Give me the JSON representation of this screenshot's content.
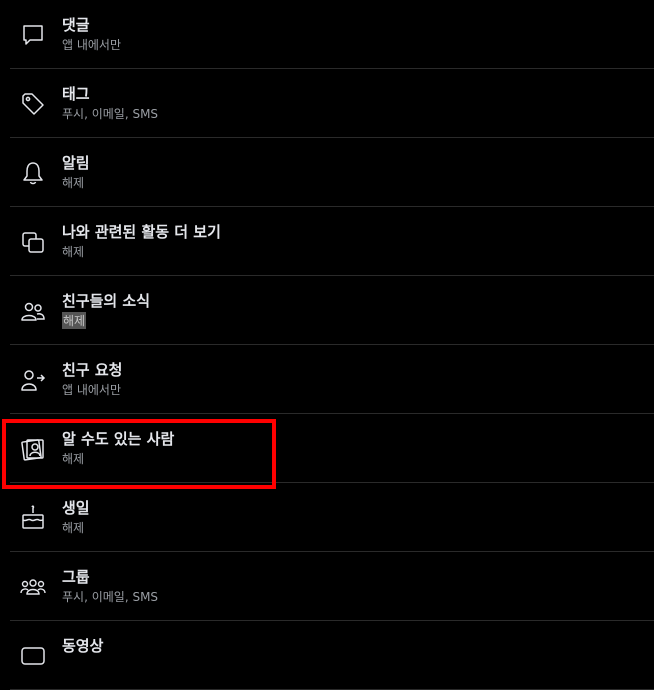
{
  "settings": {
    "items": [
      {
        "title": "댓글",
        "subtitle": "앱 내에서만",
        "icon": "comment-icon"
      },
      {
        "title": "태그",
        "subtitle": "푸시, 이메일, SMS",
        "icon": "tag-icon"
      },
      {
        "title": "알림",
        "subtitle": "해제",
        "icon": "bell-icon"
      },
      {
        "title": "나와 관련된 활동 더 보기",
        "subtitle": "해제",
        "icon": "stack-icon"
      },
      {
        "title": "친구들의 소식",
        "subtitle": "해제",
        "icon": "friends-icon"
      },
      {
        "title": "친구 요청",
        "subtitle": "앱 내에서만",
        "icon": "friend-request-icon"
      },
      {
        "title": "알 수도 있는 사람",
        "subtitle": "해제",
        "icon": "people-you-may-know-icon"
      },
      {
        "title": "생일",
        "subtitle": "해제",
        "icon": "birthday-cake-icon"
      },
      {
        "title": "그룹",
        "subtitle": "푸시, 이메일, SMS",
        "icon": "groups-icon"
      },
      {
        "title": "동영상",
        "subtitle": "",
        "icon": "video-icon"
      }
    ]
  },
  "colors": {
    "background": "#000000",
    "highlight_border": "#ff0000",
    "text_primary": "#e4e6eb",
    "text_secondary": "#9a9ea4"
  }
}
